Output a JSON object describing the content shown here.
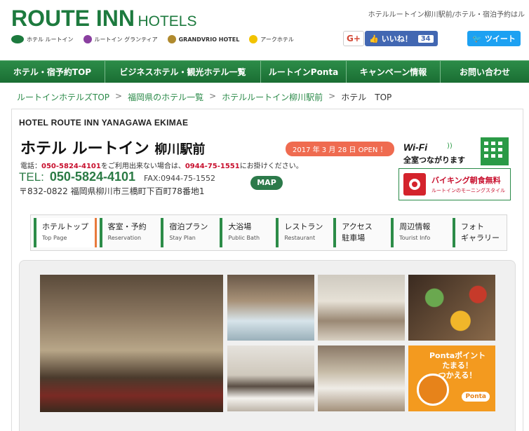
{
  "header": {
    "logo_main": "ROUTE INN",
    "logo_sub": "HOTELS",
    "tagline": "ホテルルートイン柳川駅前/ホテル・宿泊予約はル",
    "brands": [
      "ホテル ルートイン",
      "ルートイン グランティア",
      "GRANDVRIO HOTEL",
      "アークホテル"
    ]
  },
  "social": {
    "gplus_label": "G+",
    "like_label": "いいね！",
    "like_count": "34",
    "tweet_label": "ツイート"
  },
  "gnav": [
    {
      "label": "ホテル・宿予約TOP"
    },
    {
      "label": "ビジネスホテル・観光ホテル一覧"
    },
    {
      "label": "ルートインPonta"
    },
    {
      "label": "キャンペーン情報"
    },
    {
      "label": "お問い合わせ"
    }
  ],
  "breadcrumb": {
    "items": [
      "ルートインホテルズTOP",
      "福岡県のホテル一覧",
      "ホテルルートイン柳川駅前"
    ],
    "current": "ホテル　TOP",
    "separator": ">"
  },
  "hotel": {
    "name_en": "HOTEL ROUTE INN YANAGAWA EKIMAE",
    "name_jp": "ホテル ルートイン",
    "name_jp_sub": "柳川駅前",
    "open_badge": "2017 年 3 月 28 日 OPEN ！",
    "call_prefix": "電話：",
    "call_num1": "050-5824-4101",
    "call_mid": "をご利用出来ない場合は、",
    "call_num2": "0944-75-1551",
    "call_suffix": "にお掛けください。",
    "tel_label": "TEL:",
    "tel_number": "050-5824-4101",
    "fax": "FAX:0944-75-1552",
    "address": "〒832-0822 福岡県柳川市三橋町下百町78番地1",
    "map_label": "MAP"
  },
  "wifi": {
    "title": "Wi-Fi",
    "subtitle": "全室つながります"
  },
  "breakfast": {
    "title": "バイキング朝食無料",
    "subtitle": "ルートインのモーニングスタイル"
  },
  "tabs": [
    {
      "jp": "ホテルトップ",
      "en": "Top Page",
      "active": true
    },
    {
      "jp": "客室・予約",
      "en": "Reservation"
    },
    {
      "jp": "宿泊プラン",
      "en": "Stay Plan"
    },
    {
      "jp": "大浴場",
      "en": "Public Bath"
    },
    {
      "jp": "レストラン",
      "en": "Restaurant"
    },
    {
      "jp": "アクセス",
      "en": "駐車場"
    },
    {
      "jp": "周辺情報",
      "en": "Tourist Info"
    },
    {
      "jp": "フォト",
      "en": "ギャラリー"
    }
  ],
  "ponta": {
    "line1": "Pontaポイント",
    "line2": "たまる！",
    "line3": "つかえる！",
    "badge": "Ponta"
  },
  "colors": {
    "brand_green": "#1d7a3e",
    "nav_green": "#2c8c48",
    "accent_orange": "#ef6b50",
    "red": "#c8102e"
  }
}
